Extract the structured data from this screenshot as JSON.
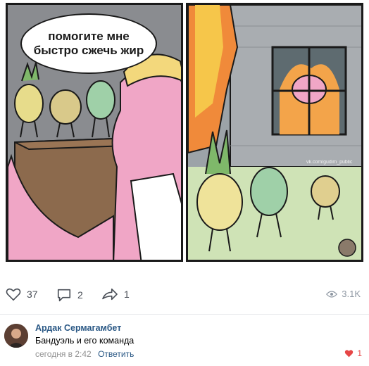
{
  "post": {
    "speech_bubble": {
      "line1": "помогите мне",
      "line2": "быстро сжечь жир"
    },
    "watermark": "vk.com/gudim_public",
    "actions": {
      "likes": "37",
      "comments": "2",
      "shares": "1",
      "views": "3.1K"
    }
  },
  "comment": {
    "author": "Ардак Сермагамбет",
    "text": "Бандуэль и его команда",
    "time": "сегодня в 2:42",
    "reply_label": "Ответить",
    "likes": "1",
    "like_color": "#e64646"
  },
  "colors": {
    "link": "#2a5885",
    "muted": "#939393",
    "icon": "#4a4f57"
  }
}
